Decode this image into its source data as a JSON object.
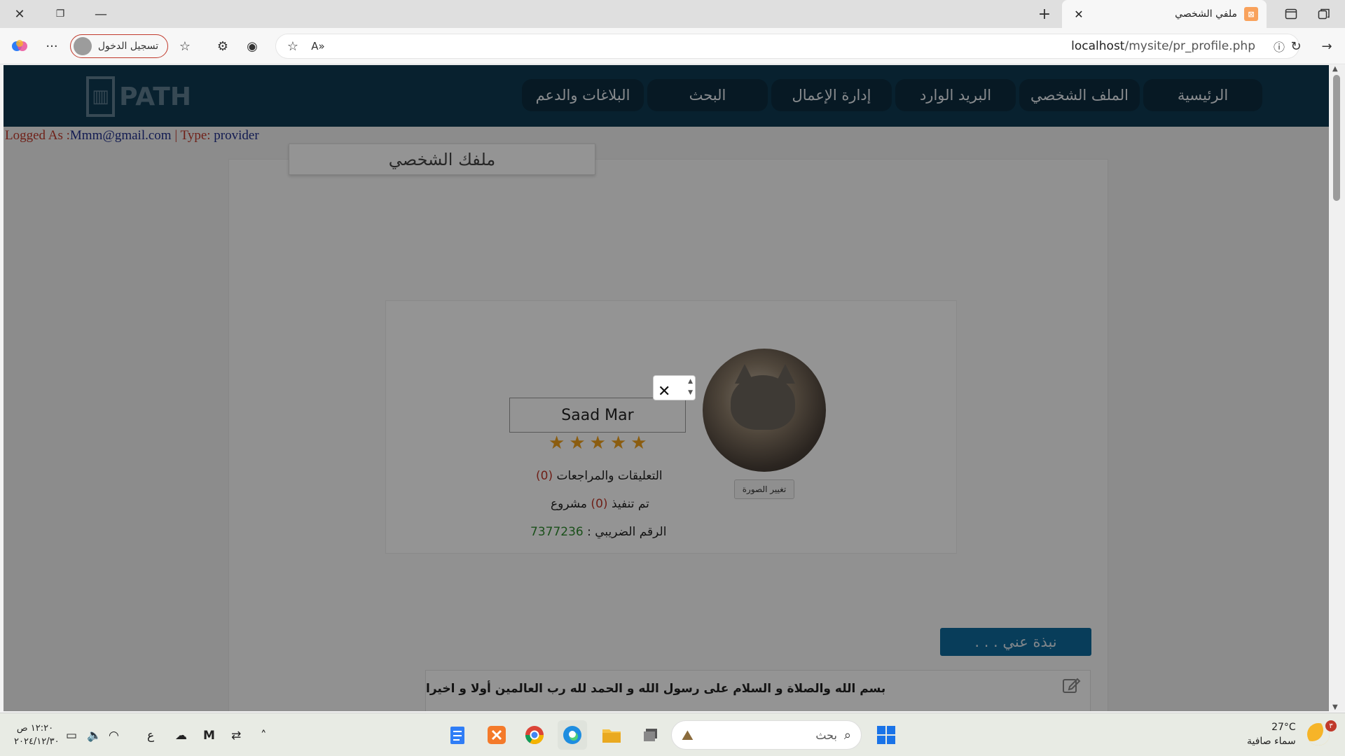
{
  "browser": {
    "tab_title": "ملفي الشخصي",
    "tab_favicon": "xampp-icon",
    "new_tab_label": "+",
    "login_button": "تسجيل الدخول",
    "url_host": "localhost",
    "url_path": "/mysite/pr_profile.php"
  },
  "site": {
    "logo_text": "PATH",
    "nav": [
      "الرئيسية",
      "الملف الشخصي",
      "البريد الوارد",
      "إدارة الإعمال",
      "البحث",
      "البلاغات والدعم"
    ],
    "logged_as_label": "Logged As :",
    "logged_as_email": "Mmm@gmail.com",
    "type_label": " | Type: ",
    "type_value": "provider"
  },
  "profile": {
    "title": "ملفك الشخصي",
    "name": "Saad Mar",
    "rating_stars": 5,
    "change_photo": "تغيير الصورة",
    "reviews_label": "التعليقات والمراجعات",
    "reviews_count": "(0)",
    "projects_prefix": "تم تنفيذ",
    "projects_count": "(0)",
    "projects_suffix": "مشروع",
    "tax_label": "الرقم الضريبي :",
    "tax_number": "7377236",
    "about_button": "نبذة عني . . .",
    "about_text": "بسم الله والصلاة و السلام على رسول الله و الحمد لله رب العالمين أولا و اخيرا"
  },
  "taskbar": {
    "search_placeholder": "بحث",
    "time": "١٢:٢٠ ص",
    "date": "٢٠٢٤/١٢/٣٠",
    "lang": "ع",
    "temp": "27°C",
    "weather_desc": "سماء صافية",
    "notification_badge": "٣"
  }
}
